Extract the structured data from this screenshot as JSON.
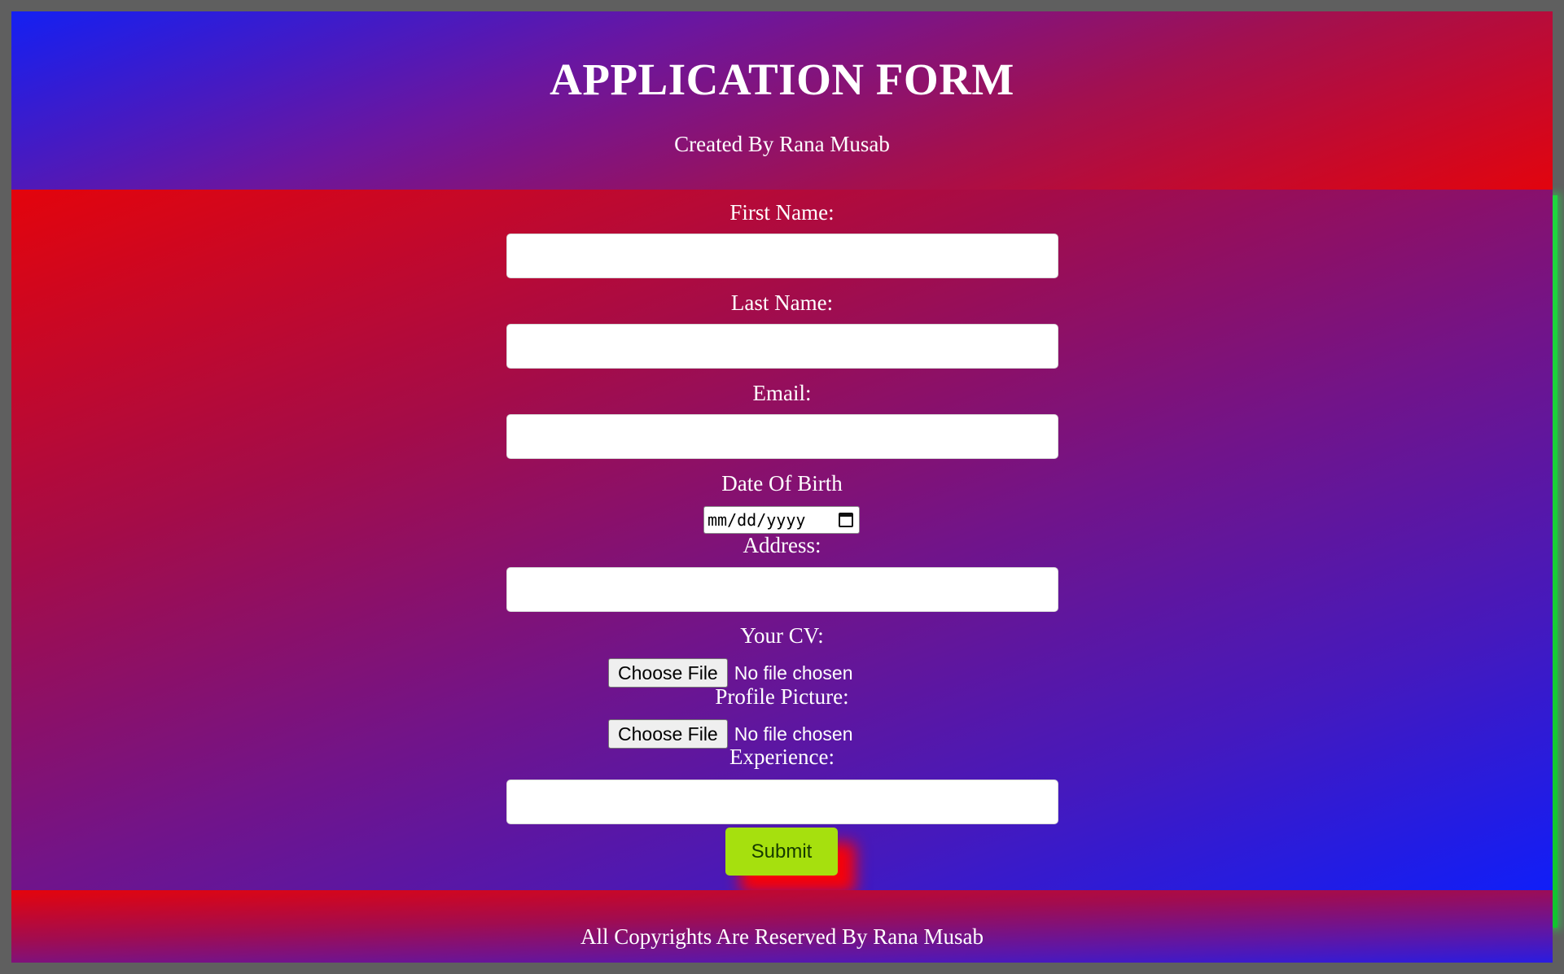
{
  "header": {
    "title": "APPLICATION FORM",
    "subtitle": "Created By Rana Musab"
  },
  "form": {
    "first_name": {
      "label": "First Name:",
      "value": ""
    },
    "last_name": {
      "label": "Last Name:",
      "value": ""
    },
    "email": {
      "label": "Email:",
      "value": ""
    },
    "dob": {
      "label": "Date Of Birth",
      "placeholder": "mm/dd/yyyy"
    },
    "address": {
      "label": "Address:",
      "value": ""
    },
    "cv": {
      "label": "Your CV:",
      "button": "Choose File",
      "status": "No file chosen"
    },
    "profile_picture": {
      "label": "Profile Picture:",
      "button": "Choose File",
      "status": "No file chosen"
    },
    "experience": {
      "label": "Experience:",
      "value": ""
    },
    "submit": "Submit"
  },
  "footer": {
    "text": "All Copyrights Are Reserved By Rana Musab"
  },
  "colors": {
    "submit_bg": "#a6e00e",
    "submit_shadow": "#ff0000",
    "side_glow": "#1fd63f"
  },
  "icons": {
    "date_picker": "calendar-icon"
  }
}
